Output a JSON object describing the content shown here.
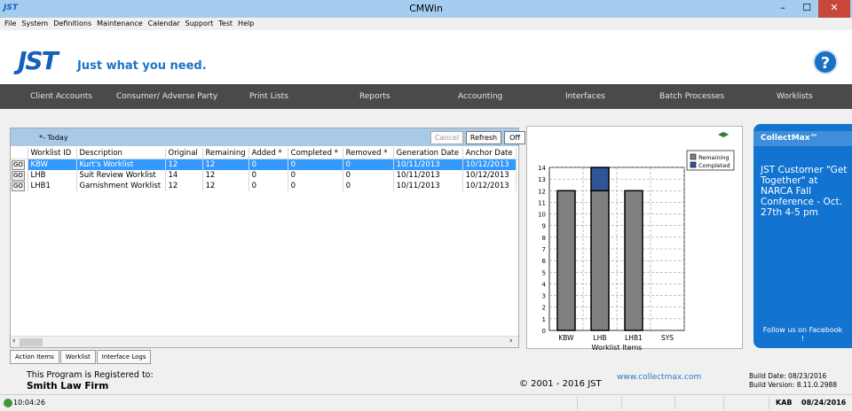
{
  "window": {
    "title": "CMWin",
    "min": "–",
    "max": "☐",
    "close": "✕"
  },
  "menu": [
    "File",
    "System",
    "Definitions",
    "Maintenance",
    "Calendar",
    "Support",
    "Test",
    "Help"
  ],
  "banner": {
    "logo": "JST",
    "tagline": "Just what you need.",
    "help": "?"
  },
  "nav": [
    "Client Accounts",
    "Consumer/ Adverse Party",
    "Print Lists",
    "Reports",
    "Accounting",
    "Interfaces",
    "Batch Processes",
    "Worklists"
  ],
  "worklists": {
    "filter_label": "*- Today",
    "buttons": {
      "cancel": "Cancel",
      "refresh": "Refresh",
      "off": "Off"
    },
    "go_label": "GO",
    "columns": [
      "Worklist ID",
      "Description",
      "Original",
      "Remaining",
      "Added *",
      "Completed *",
      "Removed *",
      "Generation Date",
      "Anchor Date"
    ],
    "rows": [
      [
        "KBW",
        "Kurt's Worklist",
        "12",
        "12",
        "0",
        "0",
        "0",
        "10/11/2013",
        "10/12/2013"
      ],
      [
        "LHB",
        "Suit Review Worklist",
        "14",
        "12",
        "0",
        "0",
        "0",
        "10/11/2013",
        "10/12/2013"
      ],
      [
        "LHB1",
        "Garnishment Worklist",
        "12",
        "12",
        "0",
        "0",
        "0",
        "10/11/2013",
        "10/12/2013"
      ]
    ],
    "selected_row": 0
  },
  "chart_data": {
    "type": "bar",
    "stacked": true,
    "categories": [
      "KBW",
      "LHB",
      "LHB1",
      "SYS"
    ],
    "series": [
      {
        "name": "Remaining",
        "values": [
          12,
          12,
          12,
          0
        ],
        "color": "#808080"
      },
      {
        "name": "Completed",
        "values": [
          0,
          2,
          0,
          0
        ],
        "color": "#2f5597"
      }
    ],
    "xlabel": "Worklist Items",
    "ylabel": "",
    "ylim": [
      0,
      14
    ],
    "yticks": [
      0,
      1,
      2,
      3,
      4,
      5,
      6,
      7,
      8,
      9,
      10,
      11,
      12,
      13,
      14
    ],
    "grid": true,
    "legend": "top-right"
  },
  "ad": {
    "title": "CollectMax™",
    "body": "JST Customer \"Get Together\" at NARCA Fall Conference - Oct. 27th 4-5 pm",
    "follow": "Follow us on Facebook !"
  },
  "tabs": [
    "Action Items",
    "Worklist",
    "Interface Logs"
  ],
  "footer": {
    "registered_label": "This Program is Registered to:",
    "firm": "Smith Law Firm",
    "copyright": "© 2001 - 2016 JST",
    "url": "www.collectmax.com",
    "build_date": "Build Date: 08/23/2016",
    "build_version": "Build Version: 8.11.0.2988"
  },
  "status": {
    "time": "10:04:26",
    "user": "KAB",
    "date": "08/24/2016"
  },
  "colors": {
    "nav_bg": "#4a4a4a",
    "accent": "#1273d1",
    "selection": "#3399ff"
  }
}
